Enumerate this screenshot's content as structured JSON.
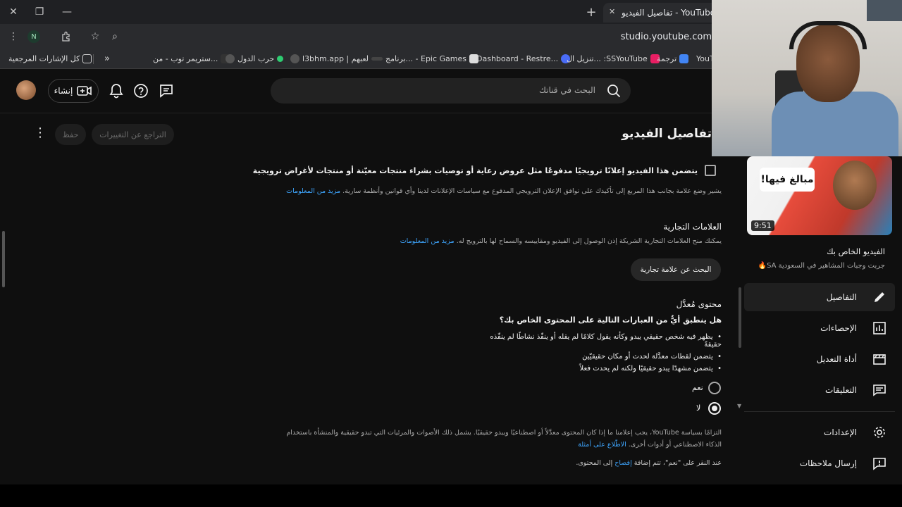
{
  "browser": {
    "tab_title": "YouTube Studio - تفاصيل الفيديو",
    "url": "studio.youtube.com",
    "profile_letter": "N",
    "bookmarks": [
      {
        "label": "YouTube"
      },
      {
        "label": "ترجمة"
      },
      {
        "label": "تنزيل ال... :SSYouTube"
      },
      {
        "label": "Dashboard - Restre..."
      },
      {
        "label": "برنامج... - Epic Games"
      },
      {
        "label": "l3bhm.app | لعبهم"
      },
      {
        "label": "حرب الدول"
      },
      {
        "label": "ستريمر توب - من..."
      }
    ],
    "all_bookmarks": "كل الإشارات المرجعية"
  },
  "header": {
    "search_placeholder": "البحث في قناتك",
    "create_label": "إنشاء"
  },
  "page": {
    "title": "تفاصيل الفيديو",
    "undo_label": "التراجع عن التغييرات",
    "save_label": "حفظ"
  },
  "promo": {
    "checkbox_label": "يتضمن هذا الفيديو إعلانًا ترويجيًا مدفوعًا مثل عروض رعاية أو توصيات بشراء منتجات معيّنة أو منتجات لأغراض ترويجية",
    "description": "يشير وضع علامة بجانب هذا المربع إلى تأكيدك على توافق الإعلان الترويجي المدفوع مع سياسات الإعلانات لدينا وأي قوانين وأنظمة سارية.",
    "more_link": "مزيد من المعلومات"
  },
  "brands": {
    "heading": "العلامات التجارية",
    "description": "يمكنك منح العلامات التجارية الشريكة إذن الوصول إلى الفيديو ومقاييسه والسماح لها بالترويج له.",
    "more_link": "مزيد من المعلومات",
    "search_button": "البحث عن علامة تجارية"
  },
  "altered": {
    "heading": "محتوى مُعدَّل",
    "question": "هل ينطبق أيٌّ من العبارات التالية على المحتوى الخاص بك؟",
    "bullets": [
      "يظهر فيه شخص حقيقي يبدو وكأنه يقول كلامًا لم يقله أو ينفّذ نشاطًا لم ينفّذه حقيقةً",
      "يتضمن لقطات معدَّلة لحدث أو مكان حقيقيّين",
      "يتضمن مشهدًا يبدو حقيقيًا ولكنه لم يحدث فعلاً"
    ],
    "option_yes": "نعم",
    "option_no": "لا",
    "selected": "لا",
    "policy_text": "التزامًا بسياسة YouTube، يجب إعلامنا ما إذا كان المحتوى معدَّلاً أو اصطناعيًا ويبدو حقيقيًا. يشمل ذلك الأصوات والمرئيات التي تبدو حقيقية والمنشأة باستخدام الذكاء الاصطناعي أو أدوات أخرى.",
    "examples_link": "الاطّلاع على أمثلة",
    "footnote_pre": "عند النقر على \"نعم\"، تتم إضافة",
    "footnote_link": "إفصاح",
    "footnote_post": "إلى المحتوى."
  },
  "sidebar": {
    "thumb_text": "مبالغ فيها!",
    "duration": "9:51",
    "video_label": "الفيديو الخاص بك",
    "video_title": "جربت وجبات المشاهير في السعودية SA🔥",
    "items": [
      {
        "label": "التفاصيل",
        "icon": "pencil-icon",
        "active": true
      },
      {
        "label": "الإحصاءات",
        "icon": "analytics-icon",
        "active": false
      },
      {
        "label": "أداة التعديل",
        "icon": "editor-icon",
        "active": false
      },
      {
        "label": "التعليقات",
        "icon": "comments-icon",
        "active": false
      },
      {
        "label": "الإعدادات",
        "icon": "gear-icon",
        "active": false
      },
      {
        "label": "إرسال ملاحظات",
        "icon": "feedback-icon",
        "active": false
      }
    ]
  },
  "colors": {
    "background": "#0f0f0f",
    "link": "#3ea6ff",
    "text": "#f1f1f1"
  }
}
